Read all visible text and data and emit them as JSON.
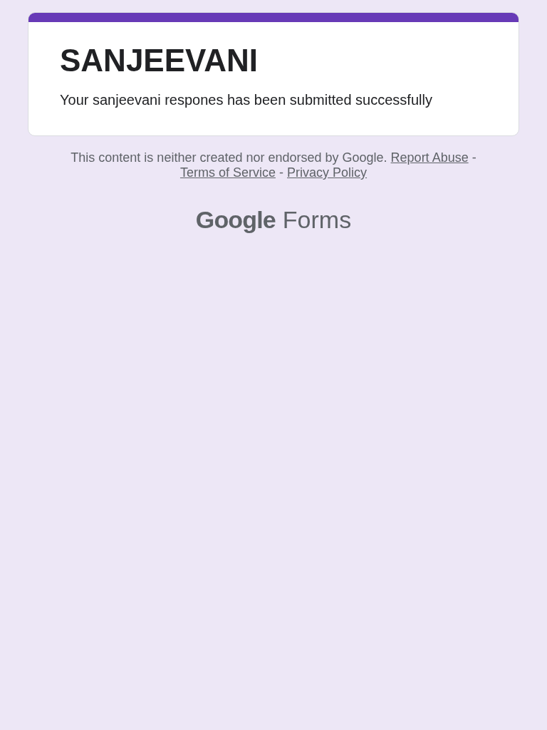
{
  "form": {
    "title": "SANJEEVANI",
    "message": "Your sanjeevani respones has been submitted successfully"
  },
  "footer": {
    "notice": "This content is neither created nor endorsed by Google.",
    "separator": "-",
    "links": [
      {
        "label": "Report Abuse"
      },
      {
        "label": "Terms of Service"
      },
      {
        "label": "Privacy Policy"
      }
    ]
  },
  "brand": {
    "logo": "Google",
    "product": "Forms"
  }
}
